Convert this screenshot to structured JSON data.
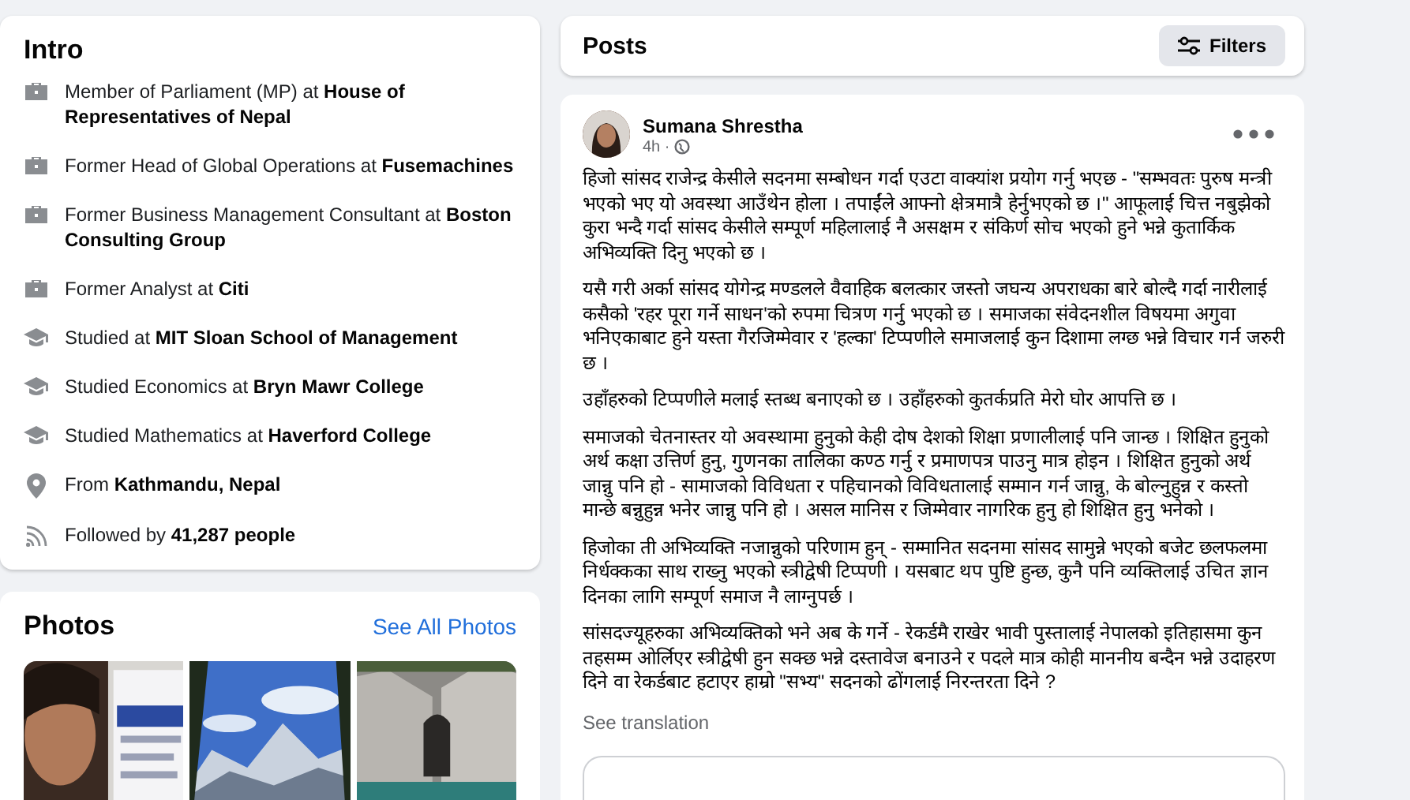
{
  "intro": {
    "title": "Intro",
    "items": [
      {
        "kind": "work",
        "text": "Member of Parliament (MP) at **House of Representatives of Nepal**"
      },
      {
        "kind": "work",
        "text": "Former Head of Global Operations at **Fusemachines**"
      },
      {
        "kind": "work",
        "text": "Former Business Management Consultant at **Boston Consulting Group**"
      },
      {
        "kind": "work",
        "text": "Former Analyst at **Citi**"
      },
      {
        "kind": "study",
        "text": "Studied at **MIT Sloan School of Management**"
      },
      {
        "kind": "study",
        "text": "Studied Economics at **Bryn Mawr College**"
      },
      {
        "kind": "study",
        "text": "Studied Mathematics at **Haverford College**"
      },
      {
        "kind": "place",
        "text": "From **Kathmandu, Nepal**"
      },
      {
        "kind": "follow",
        "text": "Followed by **41,287 people**"
      }
    ]
  },
  "photos": {
    "title": "Photos",
    "link": "See All Photos"
  },
  "posts": {
    "title": "Posts",
    "filter_button": "Filters"
  },
  "post": {
    "author": "Sumana Shrestha",
    "time": "4h ·",
    "paragraphs": [
      "हिजो सांसद राजेन्द्र केसीले सदनमा सम्बोधन गर्दा एउटा वाक्यांश प्रयोग गर्नु भएछ - \"सम्भवतः पुरुष मन्त्री भएको भए यो अवस्था आउँथेन होला । तपाईंले आफ्नो क्षेत्रमात्रै हेर्नुभएको छ ।\" आफूलाई चित्त नबुझेको कुरा भन्दै गर्दा सांसद केसीले सम्पूर्ण महिलालाई नै असक्षम र संकिर्ण सोच भएको हुने भन्ने कुतार्किक अभिव्यक्ति दिनु भएको छ ।",
      "यसै गरी अर्का सांसद योगेन्द्र मण्डलले वैवाहिक बलत्कार जस्तो जघन्य अपराधका बारे बोल्दै गर्दा नारीलाई कसैको 'रहर पूरा गर्ने साधन'को रुपमा चित्रण गर्नु भएको छ । समाजका संवेदनशील विषयमा अगुवा भनिएकाबाट हुने यस्ता गैरजिम्मेवार र 'हल्का' टिप्पणीले समाजलाई कुन दिशामा लग्छ भन्ने विचार गर्न जरुरी छ ।",
      "उहाँहरुको टिप्पणीले मलाई स्तब्ध बनाएको छ । उहाँहरुको कुतर्कप्रति मेरो घोर आपत्ति छ ।",
      "समाजको चेतनास्तर यो अवस्थामा हुनुको केही दोष देशको शिक्षा प्रणालीलाई पनि जान्छ । शिक्षित हुनुको अर्थ कक्षा उत्तिर्ण हुनु, गुणनका तालिका कण्ठ गर्नु र प्रमाणपत्र पाउनु मात्र होइन । शिक्षित हुनुको अर्थ जान्नु पनि हो - सामाजको विविधता र पहिचानको विविधतालाई सम्मान गर्न जान्नु, के बोल्नुहुन्न र कस्तो मान्छे बन्नुहुन्न भनेर जान्नु पनि हो । असल मानिस र जिम्मेवार नागरिक हुनु हो शिक्षित हुनु भनेको ।",
      "हिजोका ती अभिव्यक्ति नजान्नुको परिणाम हुन् - सम्मानित सदनमा सांसद सामुन्ने भएको बजेट छलफलमा निर्धक्कका साथ राख्नु भएको स्त्रीद्वेषी टिप्पणी । यसबाट थप पुष्टि हुन्छ, कुनै पनि व्यक्तिलाई उचित ज्ञान दिनका लागि सम्पूर्ण समाज नै लाग्नुपर्छ ।",
      "सांसदज्यूहरुका अभिव्यक्तिको भने अब के गर्ने - रेकर्डमै राखेर भावी पुस्तालाई नेपालको इतिहासमा कुन तहसम्म ओर्लिएर स्त्रीद्वेषी हुन सक्छ भन्ने दस्तावेज बनाउने र पदले मात्र कोही माननीय बन्दैन भन्ने उदाहरण दिने वा रेकर्डबाट हटाएर हाम्रो \"सभ्य\" सदनको ढोंगलाई निरन्तरता दिने ?"
    ],
    "translate_link": "See translation"
  }
}
